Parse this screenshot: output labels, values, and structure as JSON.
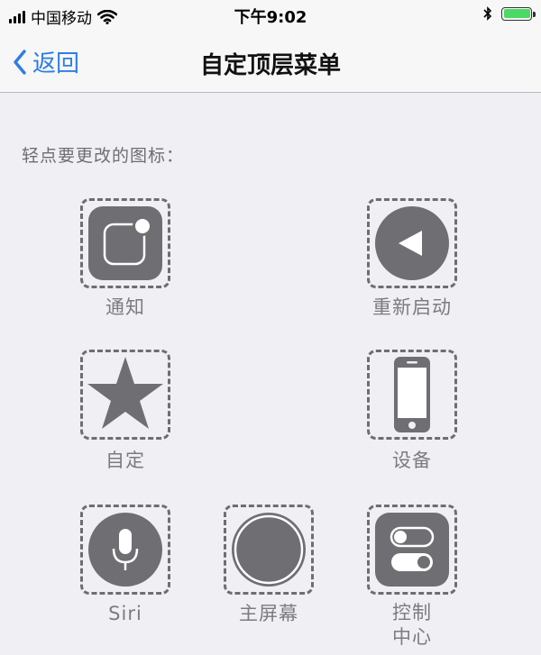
{
  "status_bar": {
    "carrier": "中国移动",
    "time": "下午9:02",
    "signal_bars": 4,
    "battery_level": 1.0,
    "icons": [
      "wifi-icon",
      "bluetooth-icon",
      "battery-icon"
    ]
  },
  "nav": {
    "back_label": "返回",
    "title": "自定顶层菜单"
  },
  "instruction": "轻点要更改的图标：",
  "menu_items": [
    {
      "label": "通知",
      "icon": "notification-icon"
    },
    {
      "label": "重新启动",
      "icon": "restart-icon"
    },
    {
      "label": "自定",
      "icon": "star-icon"
    },
    {
      "label": "设备",
      "icon": "device-icon"
    },
    {
      "label": "Siri",
      "icon": "microphone-icon"
    },
    {
      "label": "主屏幕",
      "icon": "home-button-icon"
    },
    {
      "label": "控制中心",
      "label_line1": "控制",
      "label_line2": "中心",
      "icon": "control-center-icon"
    }
  ],
  "colors": {
    "accent": "#2f7de1",
    "icon_gray": "#6f6f73",
    "battery_green": "#4cd964",
    "background": "#efeff4"
  }
}
